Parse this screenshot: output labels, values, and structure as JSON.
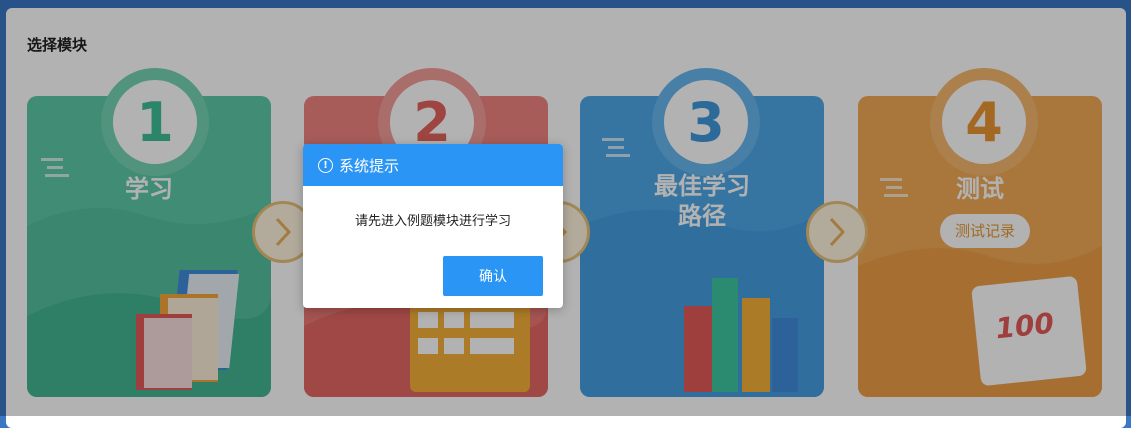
{
  "panel": {
    "title": "选择模块"
  },
  "cards": [
    {
      "number": "1",
      "title": "学习",
      "color": "#5ec9a8",
      "badge_color": "#74d3b4",
      "number_color": "#3fbf97"
    },
    {
      "number": "2",
      "title": "",
      "color": "#f08480",
      "badge_color": "#f29c98",
      "number_color": "#e2645e"
    },
    {
      "number": "3",
      "title_line1": "最佳学习",
      "title_line2": "路径",
      "color": "#4ea8e8",
      "badge_color": "#66b6ee",
      "number_color": "#3e98dc"
    },
    {
      "number": "4",
      "title": "测试",
      "record_label": "测试记录",
      "color": "#f2a955",
      "badge_color": "#f5b86f",
      "number_color": "#ea9531"
    }
  ],
  "dialog": {
    "title": "系统提示",
    "message": "请先进入例题模块进行学习",
    "confirm_label": "确认"
  },
  "score_text": "100"
}
